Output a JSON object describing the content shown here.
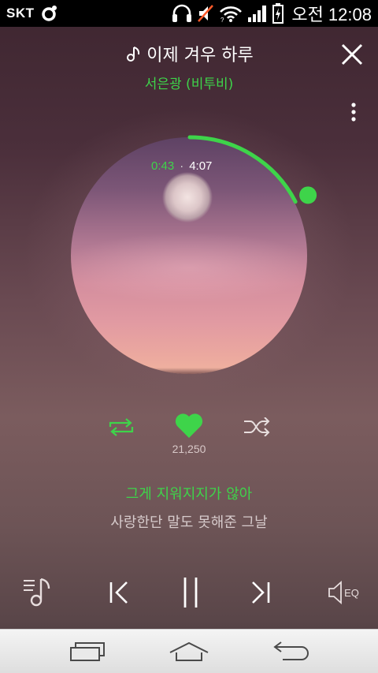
{
  "status_bar": {
    "carrier": "SKT",
    "time": "오전 12:08",
    "icons": [
      "carrier-app-icon",
      "headset-icon",
      "mute-icon",
      "wifi-icon",
      "signal-icon",
      "battery-charging-icon"
    ]
  },
  "player": {
    "song_title": "이제 겨우 하루",
    "artist": "서은광 (비투비)",
    "elapsed": "0:43",
    "separator": "·",
    "total": "4:07",
    "progress_fraction": 0.174,
    "like_count": "21,250",
    "lyric_current": "그게 지워지지가 않아",
    "lyric_next": "사랑한단 말도 못해준 그날",
    "eq_label": "EQ"
  },
  "colors": {
    "accent_green": "#3ed44a",
    "status_bar_bg": "#000000",
    "nav_bar_bg": "#e8e8e8"
  }
}
